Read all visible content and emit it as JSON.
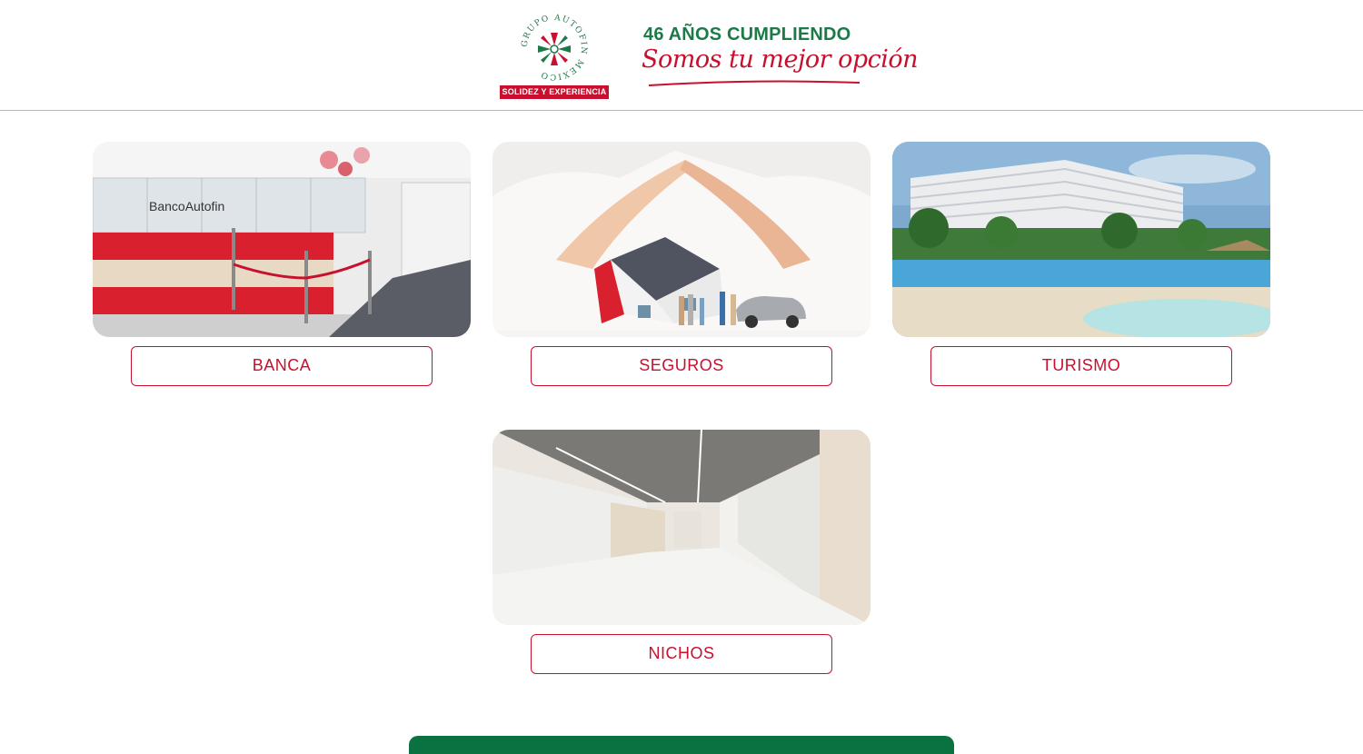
{
  "header": {
    "logo": {
      "arc_text": "GRUPO AUTOFIN MEXICO",
      "tagline": "SOLIDEZ Y EXPERIENCIA"
    },
    "anniversary": "46 AÑOS CUMPLIENDO",
    "slogan": "Somos tu mejor opción"
  },
  "colors": {
    "brand_red": "#c8102e",
    "brand_green": "#0a7241"
  },
  "cards": [
    {
      "label": "BANCA",
      "image": "bank-branch-photo",
      "sign": "BancoAutofin"
    },
    {
      "label": "SEGUROS",
      "image": "insurance-house-hands-photo"
    },
    {
      "label": "TURISMO",
      "image": "resort-hotel-photo"
    },
    {
      "label": "NICHOS",
      "image": "columbarium-niches-photo"
    }
  ]
}
